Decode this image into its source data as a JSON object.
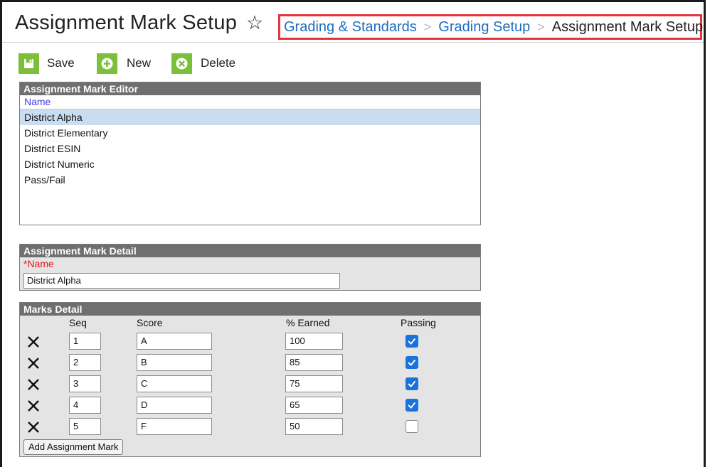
{
  "header": {
    "title": "Assignment Mark Setup",
    "breadcrumb": [
      "Grading & Standards",
      "Grading Setup",
      "Assignment Mark Setup"
    ]
  },
  "toolbar": {
    "save_label": "Save",
    "new_label": "New",
    "delete_label": "Delete"
  },
  "editor": {
    "title": "Assignment Mark Editor",
    "column": "Name",
    "items": [
      "District Alpha",
      "District Elementary",
      "District ESIN",
      "District Numeric",
      "Pass/Fail"
    ],
    "selected": "District Alpha"
  },
  "detail": {
    "title": "Assignment Mark Detail",
    "name_label": "*Name",
    "name_value": "District Alpha"
  },
  "marks": {
    "title": "Marks Detail",
    "headers": {
      "seq": "Seq",
      "score": "Score",
      "earned": "% Earned",
      "passing": "Passing"
    },
    "rows": [
      {
        "seq": "1",
        "score": "A",
        "earned": "100",
        "passing": true
      },
      {
        "seq": "2",
        "score": "B",
        "earned": "85",
        "passing": true
      },
      {
        "seq": "3",
        "score": "C",
        "earned": "75",
        "passing": true
      },
      {
        "seq": "4",
        "score": "D",
        "earned": "65",
        "passing": true
      },
      {
        "seq": "5",
        "score": "F",
        "earned": "50",
        "passing": false
      }
    ],
    "add_label": "Add Assignment Mark"
  },
  "colors": {
    "accent_green": "#7bbf3a",
    "panel_header": "#6f6f6f",
    "link": "#1f6cbf",
    "highlight_border": "#e2343d",
    "checkbox": "#1a73d9"
  }
}
